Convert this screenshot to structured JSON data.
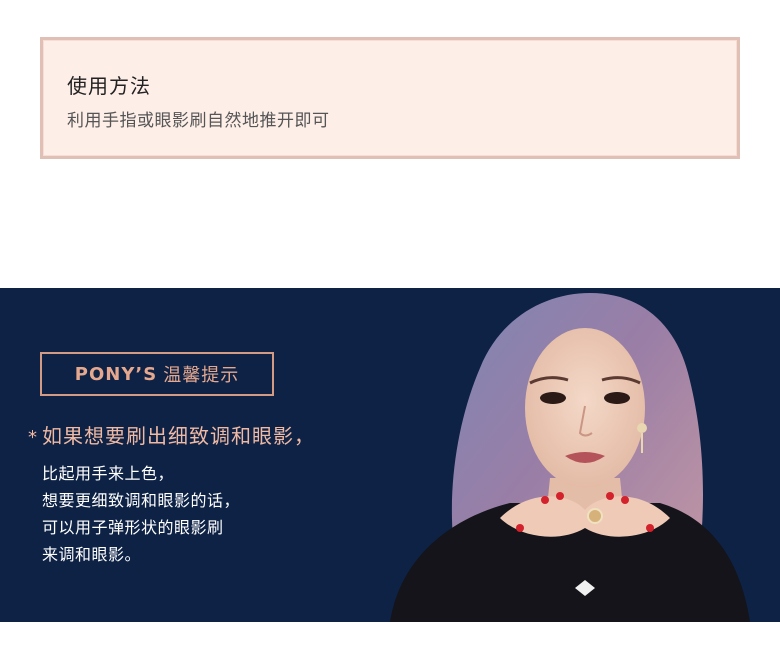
{
  "usage": {
    "title": "使用方法",
    "text": "利用手指或眼影刷自然地推开即可"
  },
  "tips": {
    "badge_brand": "PONY’S",
    "badge_cjk": "温馨提示",
    "star": "*",
    "heading": "如果想要刷出细致调和眼影，",
    "lines": [
      "比起用手来上色，",
      "想要更细致调和眼影的话，",
      "可以用子弹形状的眼影刷",
      "来调和眼影。"
    ]
  },
  "colors": {
    "usage_bg": "#fdeee8",
    "usage_border": "#e0bfb5",
    "promo_bg": "#0d2245",
    "accent": "#e5a88f"
  },
  "icons": [
    "star-icon"
  ]
}
